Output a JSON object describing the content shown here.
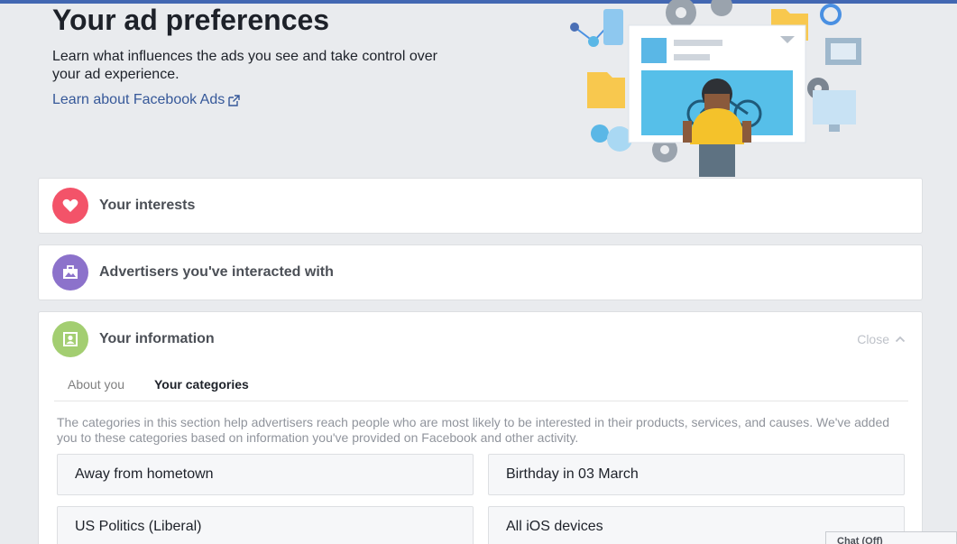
{
  "header": {
    "title": "Your ad preferences",
    "description": "Learn what influences the ads you see and take control over your ad experience.",
    "learn_link": "Learn about Facebook Ads",
    "learn_link_icon": "external-link-icon"
  },
  "sections": [
    {
      "title": "Your interests",
      "icon": "heart-icon",
      "color": "#f35369"
    },
    {
      "title": "Advertisers you've interacted with",
      "icon": "briefcase-icon",
      "color": "#8c72cb"
    },
    {
      "title": "Your information",
      "icon": "id-card-icon",
      "color": "#a3ce71"
    }
  ],
  "your_information": {
    "close_label": "Close",
    "tabs": [
      {
        "label": "About you",
        "active": false
      },
      {
        "label": "Your categories",
        "active": true
      }
    ],
    "description": "The categories in this section help advertisers reach people who are most likely to be interested in their products, services, and causes. We've added you to these categories based on information you've provided on Facebook and other activity.",
    "categories": [
      "Away from hometown",
      "Birthday in 03 March",
      "US Politics (Liberal)",
      "All iOS devices"
    ]
  },
  "chat": {
    "label": "Chat (Off)"
  },
  "colors": {
    "link": "#365899",
    "topbar": "#4267b2",
    "background": "#e9ebee"
  }
}
